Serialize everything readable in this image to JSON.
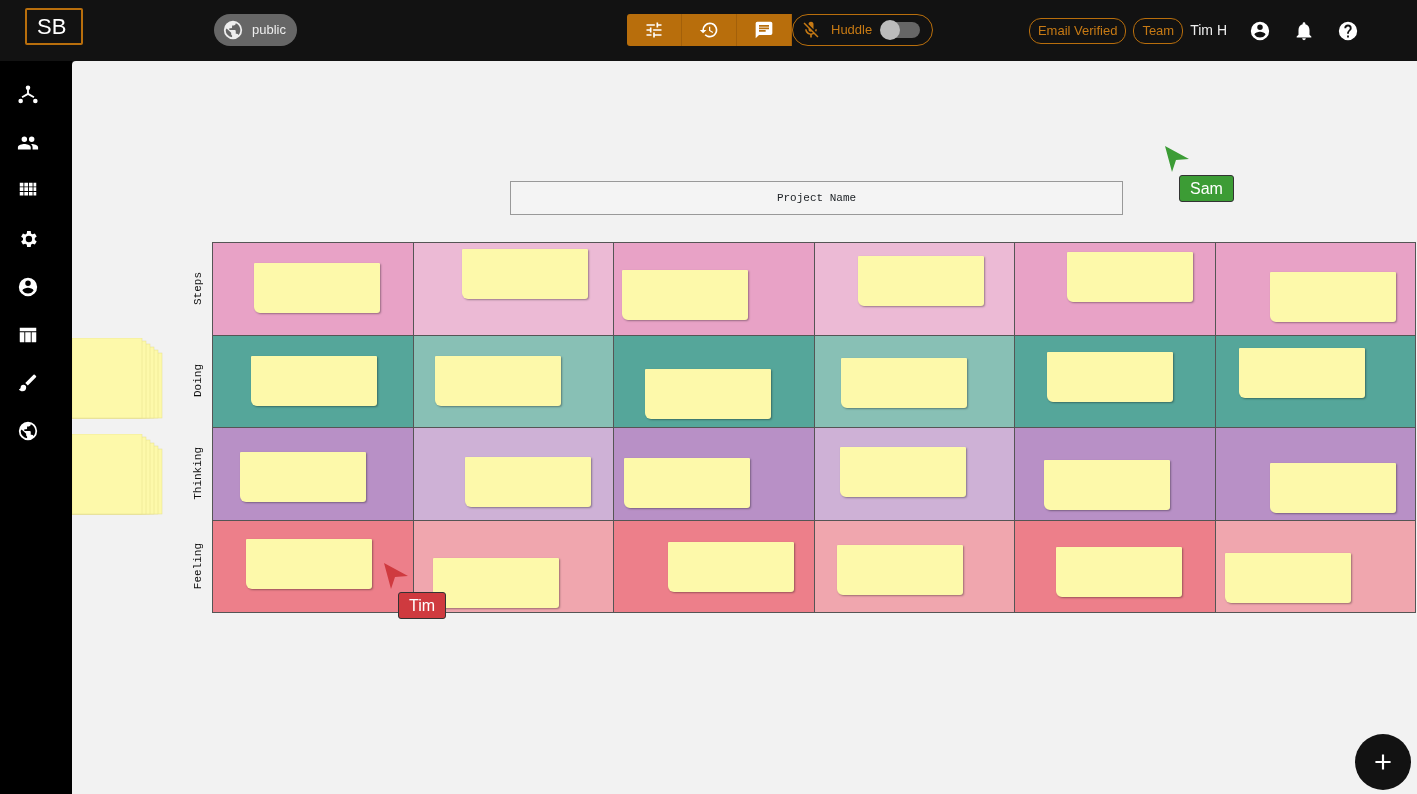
{
  "header": {
    "logo": "SB",
    "visibility": "public",
    "huddle": {
      "label": "Huddle",
      "on": false
    },
    "badges": [
      "Email Verified",
      "Team"
    ],
    "user": "Tim H"
  },
  "board": {
    "title": "Project Name",
    "rows": [
      {
        "label": "Steps",
        "cells": [
          {
            "color": "#e8a2c6"
          },
          {
            "color": "#ecbad5"
          },
          {
            "color": "#e8a2c6"
          },
          {
            "color": "#ecbad5"
          },
          {
            "color": "#e8a2c6"
          },
          {
            "color": "#e8a2c6"
          }
        ]
      },
      {
        "label": "Doing",
        "cells": [
          {
            "color": "#55a69a"
          },
          {
            "color": "#88c0b5"
          },
          {
            "color": "#55a69a"
          },
          {
            "color": "#88c0b5"
          },
          {
            "color": "#55a69a"
          },
          {
            "color": "#55a69a"
          }
        ]
      },
      {
        "label": "Thinking",
        "cells": [
          {
            "color": "#b890c6"
          },
          {
            "color": "#ceb1d6"
          },
          {
            "color": "#b890c6"
          },
          {
            "color": "#ceb1d6"
          },
          {
            "color": "#b890c6"
          },
          {
            "color": "#b890c6"
          }
        ]
      },
      {
        "label": "Feeling",
        "cells": [
          {
            "color": "#ed7f8a"
          },
          {
            "color": "#f0a6ae"
          },
          {
            "color": "#ed7f8a"
          },
          {
            "color": "#f0a6ae"
          },
          {
            "color": "#ed7f8a"
          },
          {
            "color": "#f0a6ae"
          }
        ]
      }
    ]
  },
  "cursors": [
    {
      "name": "Sam",
      "color": "#3c9c35"
    },
    {
      "name": "Tim",
      "color": "#cf3a3f"
    }
  ]
}
